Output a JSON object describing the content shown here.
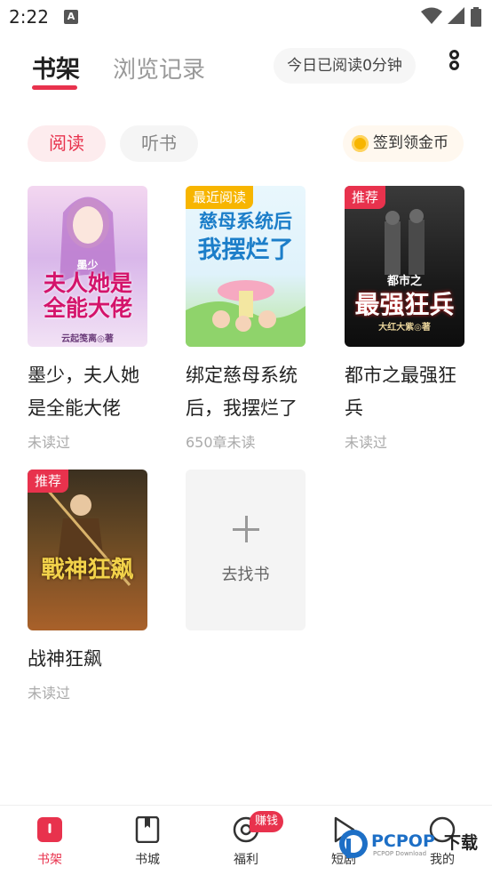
{
  "status_bar": {
    "time": "2:22",
    "notification_icon": "A"
  },
  "header": {
    "tabs": [
      {
        "label": "书架",
        "active": true
      },
      {
        "label": "浏览记录",
        "active": false
      }
    ],
    "reading_today": "今日已阅读0分钟",
    "more_icon": "more-vertical-icon"
  },
  "filters": {
    "chips": [
      {
        "label": "阅读",
        "active": true
      },
      {
        "label": "听书",
        "active": false
      }
    ],
    "checkin": "签到领金币"
  },
  "books": [
    {
      "title": "墨少，夫人她是全能大佬",
      "status": "未读过",
      "badge": "",
      "cover_text": "夫人她是全能大佬",
      "cover_small": "墨少",
      "cover_author": "云起笺离◎著"
    },
    {
      "title": "绑定慈母系统后，我摆烂了",
      "status": "650章未读",
      "badge": "最近阅读",
      "cover_text": "慈母系统后",
      "cover_text2": "我摆烂了"
    },
    {
      "title": "都市之最强狂兵",
      "status": "未读过",
      "badge": "推荐",
      "cover_text": "最强狂兵",
      "cover_small": "都市之",
      "cover_author": "大红大紫◎著"
    },
    {
      "title": "战神狂飙",
      "status": "未读过",
      "badge": "推荐",
      "cover_text": "戰神狂飙"
    }
  ],
  "add_book": {
    "label": "去找书"
  },
  "bottom_nav": {
    "items": [
      {
        "label": "书架",
        "icon": "bookshelf-icon",
        "active": true
      },
      {
        "label": "书城",
        "icon": "bookstore-icon",
        "active": false
      },
      {
        "label": "福利",
        "icon": "welfare-icon",
        "active": false
      },
      {
        "label": "短剧",
        "icon": "play-icon",
        "active": false
      },
      {
        "label": "我的",
        "icon": "profile-icon",
        "active": false
      }
    ],
    "earn_badge": "赚钱"
  },
  "watermark": {
    "brand": "PCPOP",
    "cn": "下载",
    "sub": "PCPOP Download"
  },
  "colors": {
    "accent": "#e8324d",
    "gold": "#f7b500"
  }
}
